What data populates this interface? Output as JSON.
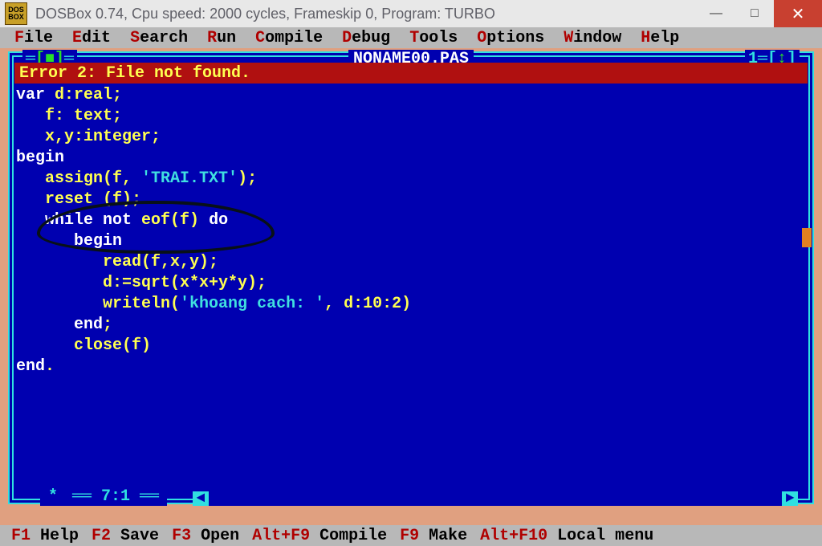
{
  "titlebar": {
    "icon_label": "DOS\nBOX",
    "text": "DOSBox 0.74, Cpu speed:    2000 cycles, Frameskip  0, Program:    TURBO",
    "minimize": "—",
    "maximize": "□",
    "close": "✕"
  },
  "menubar": [
    {
      "hot": "F",
      "rest": "ile"
    },
    {
      "hot": "E",
      "rest": "dit"
    },
    {
      "hot": "S",
      "rest": "earch"
    },
    {
      "hot": "R",
      "rest": "un"
    },
    {
      "hot": "C",
      "rest": "ompile"
    },
    {
      "hot": "D",
      "rest": "ebug"
    },
    {
      "hot": "T",
      "rest": "ools"
    },
    {
      "hot": "O",
      "rest": "ptions"
    },
    {
      "hot": "W",
      "rest": "indow"
    },
    {
      "hot": "H",
      "rest": "elp"
    }
  ],
  "editor": {
    "title": "NONAME00.PAS",
    "close_box": "[■]",
    "window_num_prefix": "1═[",
    "window_num_arrow": "↕",
    "window_num_suffix": "]",
    "error": " Error 2: File not found.",
    "cursor_pos": "7:1",
    "modified_marker": "*",
    "code_lines": [
      [
        {
          "t": "var ",
          "c": "kw"
        },
        {
          "t": "d:real;",
          "c": "sym"
        }
      ],
      [
        {
          "t": "   f: text;",
          "c": "sym"
        }
      ],
      [
        {
          "t": "   x,y:integer;",
          "c": "sym"
        }
      ],
      [
        {
          "t": "begin",
          "c": "kw"
        }
      ],
      [
        {
          "t": "   assign(f, ",
          "c": "sym"
        },
        {
          "t": "'TRAI.TXT'",
          "c": "str"
        },
        {
          "t": ");",
          "c": "sym"
        }
      ],
      [
        {
          "t": "   reset (f);",
          "c": "sym"
        }
      ],
      [
        {
          "t": "   ",
          "c": "sym"
        },
        {
          "t": "while not ",
          "c": "kw"
        },
        {
          "t": "eof(f) ",
          "c": "sym"
        },
        {
          "t": "do",
          "c": "kw"
        }
      ],
      [
        {
          "t": "      ",
          "c": "sym"
        },
        {
          "t": "begin",
          "c": "kw"
        }
      ],
      [
        {
          "t": "         read(f,x,y);",
          "c": "sym"
        }
      ],
      [
        {
          "t": "         d:=sqrt(x*x+y*y);",
          "c": "sym"
        }
      ],
      [
        {
          "t": "         writeln(",
          "c": "sym"
        },
        {
          "t": "'khoang cach: '",
          "c": "str"
        },
        {
          "t": ", d:10:2)",
          "c": "sym"
        }
      ],
      [
        {
          "t": "      ",
          "c": "sym"
        },
        {
          "t": "end",
          "c": "kw"
        },
        {
          "t": ";",
          "c": "sym"
        }
      ],
      [
        {
          "t": "      close(f)",
          "c": "sym"
        }
      ],
      [
        {
          "t": "end",
          "c": "kw"
        },
        {
          "t": ".",
          "c": "sym"
        }
      ]
    ]
  },
  "shortcuts": [
    {
      "key": "F1",
      "label": " Help"
    },
    {
      "key": "F2",
      "label": " Save"
    },
    {
      "key": "F3",
      "label": " Open"
    },
    {
      "key": "Alt+F9",
      "label": " Compile"
    },
    {
      "key": "F9",
      "label": " Make"
    },
    {
      "key": "Alt+F10",
      "label": " Local menu"
    }
  ]
}
